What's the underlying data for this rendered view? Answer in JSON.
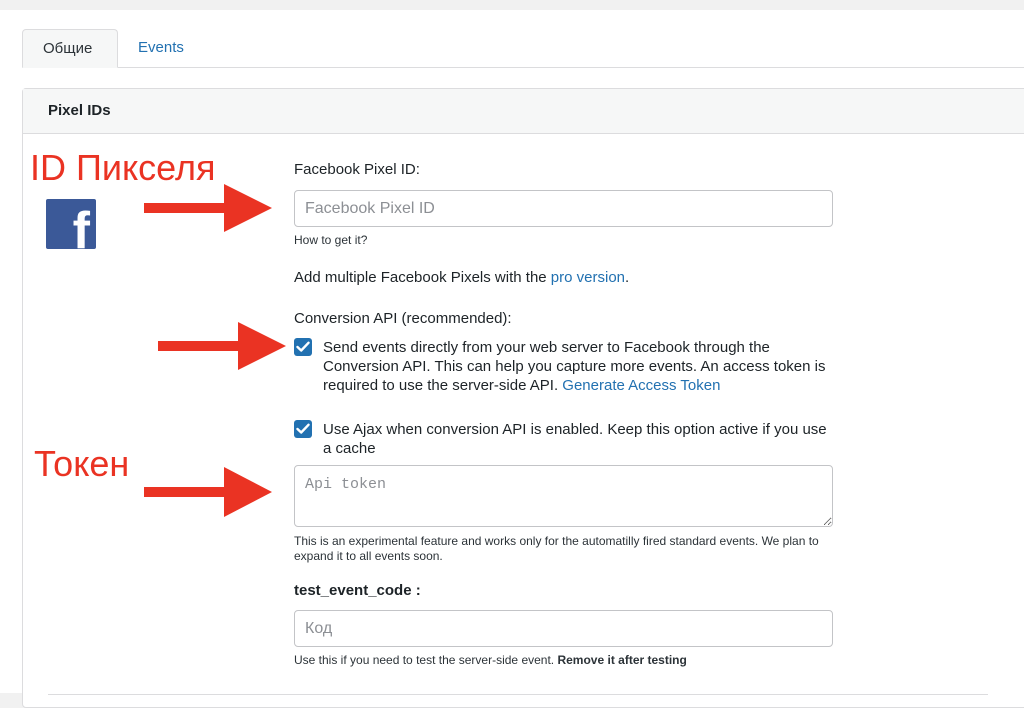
{
  "tabs": [
    {
      "label": "Общие",
      "active": true
    },
    {
      "label": "Events",
      "active": false
    }
  ],
  "card": {
    "title": "Pixel IDs"
  },
  "annotations": {
    "pixel_label": "ID Пикселя",
    "token_label": "Токен",
    "arrow_color": "#ea3323"
  },
  "logo": {
    "icon": "facebook-logo-icon",
    "color": "#3b5998"
  },
  "pixel_field": {
    "label": "Facebook Pixel ID:",
    "value": "",
    "placeholder": "Facebook Pixel ID",
    "help_link": "How to get it?"
  },
  "pro": {
    "text": "Add multiple Facebook Pixels with the ",
    "link": "pro version",
    "suffix": "."
  },
  "capi": {
    "heading": "Conversion API (recommended):",
    "send_events": {
      "checked": true,
      "text": "Send events directly from your web server to Facebook through the Conversion API. This can help you capture more events. An access token is required to use the server-side API.",
      "link": "Generate Access Token"
    },
    "use_ajax": {
      "checked": true,
      "text": "Use Ajax when conversion API is enabled. Keep this option active if you use a cache"
    },
    "token": {
      "value": "",
      "placeholder": "Api token"
    },
    "note": "This is an experimental feature and works only for the automatilly fired standard events. We plan to expand it to all events soon."
  },
  "test_event": {
    "label": "test_event_code :",
    "value": "",
    "placeholder": "Код",
    "help": "Use this if you need to test the server-side event. ",
    "help_bold": "Remove it after testing"
  },
  "colors": {
    "accent": "#2271b1",
    "annotation": "#ea3323"
  }
}
